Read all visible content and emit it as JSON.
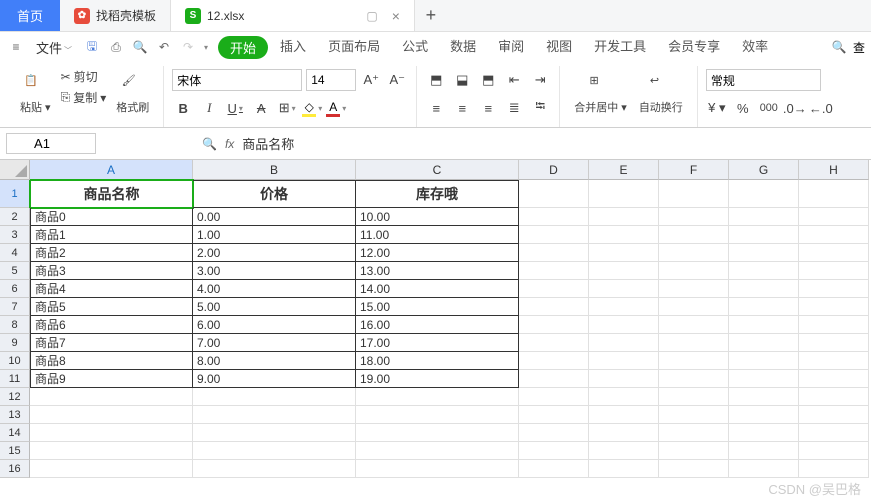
{
  "tabs": {
    "home": "首页",
    "t1": "找稻壳模板",
    "t2": "12.xlsx"
  },
  "menu": {
    "file": "文件",
    "start": "开始",
    "items": [
      "插入",
      "页面布局",
      "公式",
      "数据",
      "审阅",
      "视图",
      "开发工具",
      "会员专享",
      "效率"
    ],
    "search": "查"
  },
  "toolbar": {
    "cut": "剪切",
    "paste": "粘贴",
    "copy": "复制",
    "format_painter": "格式刷",
    "font": "宋体",
    "size": "14",
    "merge": "合并居中",
    "wrap": "自动换行",
    "numfmt": "常规"
  },
  "formula": {
    "cell_ref": "A1",
    "fx": "fx",
    "value": "商品名称"
  },
  "columns": [
    "A",
    "B",
    "C",
    "D",
    "E",
    "F",
    "G",
    "H"
  ],
  "header_row": [
    "商品名称",
    "价格",
    "库存哦"
  ],
  "data_rows": [
    {
      "n": "2",
      "a": "商品0",
      "b": "0.00",
      "c": "10.00"
    },
    {
      "n": "3",
      "a": "商品1",
      "b": "1.00",
      "c": "11.00"
    },
    {
      "n": "4",
      "a": "商品2",
      "b": "2.00",
      "c": "12.00"
    },
    {
      "n": "5",
      "a": "商品3",
      "b": "3.00",
      "c": "13.00"
    },
    {
      "n": "6",
      "a": "商品4",
      "b": "4.00",
      "c": "14.00"
    },
    {
      "n": "7",
      "a": "商品5",
      "b": "5.00",
      "c": "15.00"
    },
    {
      "n": "8",
      "a": "商品6",
      "b": "6.00",
      "c": "16.00"
    },
    {
      "n": "9",
      "a": "商品7",
      "b": "7.00",
      "c": "17.00"
    },
    {
      "n": "10",
      "a": "商品8",
      "b": "8.00",
      "c": "18.00"
    },
    {
      "n": "11",
      "a": "商品9",
      "b": "9.00",
      "c": "19.00"
    }
  ],
  "empty_rows": [
    "12",
    "13",
    "14",
    "15",
    "16"
  ],
  "watermark": "CSDN @吴巴格",
  "chart_data": {
    "type": "table",
    "title": "12.xlsx",
    "columns": [
      "商品名称",
      "价格",
      "库存哦"
    ],
    "rows": [
      [
        "商品0",
        0.0,
        10.0
      ],
      [
        "商品1",
        1.0,
        11.0
      ],
      [
        "商品2",
        2.0,
        12.0
      ],
      [
        "商品3",
        3.0,
        13.0
      ],
      [
        "商品4",
        4.0,
        14.0
      ],
      [
        "商品5",
        5.0,
        15.0
      ],
      [
        "商品6",
        6.0,
        16.0
      ],
      [
        "商品7",
        7.0,
        17.0
      ],
      [
        "商品8",
        8.0,
        18.0
      ],
      [
        "商品9",
        9.0,
        19.0
      ]
    ]
  }
}
